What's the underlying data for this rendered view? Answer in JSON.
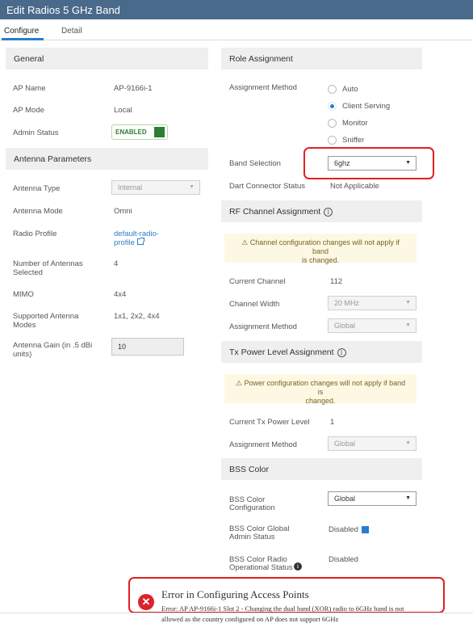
{
  "title": "Edit Radios 5 GHz Band",
  "tabs": [
    "Configure",
    "Detail"
  ],
  "general": {
    "heading": "General",
    "ap_name_label": "AP Name",
    "ap_name": "AP-9166i-1",
    "ap_mode_label": "AP Mode",
    "ap_mode": "Local",
    "admin_status_label": "Admin Status",
    "admin_status": "ENABLED"
  },
  "antenna": {
    "heading": "Antenna Parameters",
    "type_label": "Antenna Type",
    "type": "Internal",
    "mode_label": "Antenna Mode",
    "mode": "Omni",
    "profile_label": "Radio Profile",
    "profile_line1": "default-radio-",
    "profile_line2": "profile",
    "num_label_1": "Number of Antennas",
    "num_label_2": "Selected",
    "num": "4",
    "mimo_label": "MIMO",
    "mimo": "4x4",
    "supported_label_1": "Supported Antenna",
    "supported_label_2": "Modes",
    "supported": "1x1, 2x2, 4x4",
    "gain_label_1": "Antenna Gain (in .5 dBi",
    "gain_label_2": "units)",
    "gain": "10"
  },
  "role": {
    "heading": "Role Assignment",
    "method_label": "Assignment Method",
    "options": [
      "Auto",
      "Client Serving",
      "Monitor",
      "Sniffer"
    ],
    "selected": "Client Serving",
    "band_label": "Band Selection",
    "band": "6ghz",
    "dart_label": "Dart Connector Status",
    "dart": "Not Applicable"
  },
  "rf": {
    "heading": "RF Channel Assignment",
    "warning_1": "Channel configuration changes will not apply if band",
    "warning_2": "is changed.",
    "current_label": "Current Channel",
    "current": "112",
    "width_label": "Channel Width",
    "width": "20 MHz",
    "method_label": "Assignment Method",
    "method": "Global"
  },
  "tx": {
    "heading": "Tx Power Level Assignment",
    "warning_1": "Power configuration changes will not apply if band is",
    "warning_2": "changed.",
    "current_label": "Current Tx Power Level",
    "current": "1",
    "method_label": "Assignment Method",
    "method": "Global"
  },
  "bss": {
    "heading": "BSS Color",
    "config_label_1": "BSS Color",
    "config_label_2": "Configuration",
    "config": "Global",
    "admin_label_1": "BSS Color Global",
    "admin_label_2": "Admin Status",
    "admin": "Disabled",
    "oper_label_1": "BSS Color Radio",
    "oper_label_2": "Operational Status",
    "oper": "Disabled"
  },
  "error": {
    "title": "Error in Configuring Access Points",
    "line1": "Error: AP AP-9166i-1 Slot 2 - Changing the dual band (XOR) radio to 6GHz band is not",
    "line2": "allowed as the country configured on AP does not support 6GHz"
  },
  "colors": {
    "titlebar": "#4a6a8c",
    "accent": "#2a7dc9",
    "error": "#d9232d",
    "highlight": "#e02020",
    "enabled": "#2e7d32"
  },
  "icons": [
    "info-icon",
    "external-link-icon",
    "warning-icon",
    "error-icon",
    "chevron-down-icon"
  ]
}
